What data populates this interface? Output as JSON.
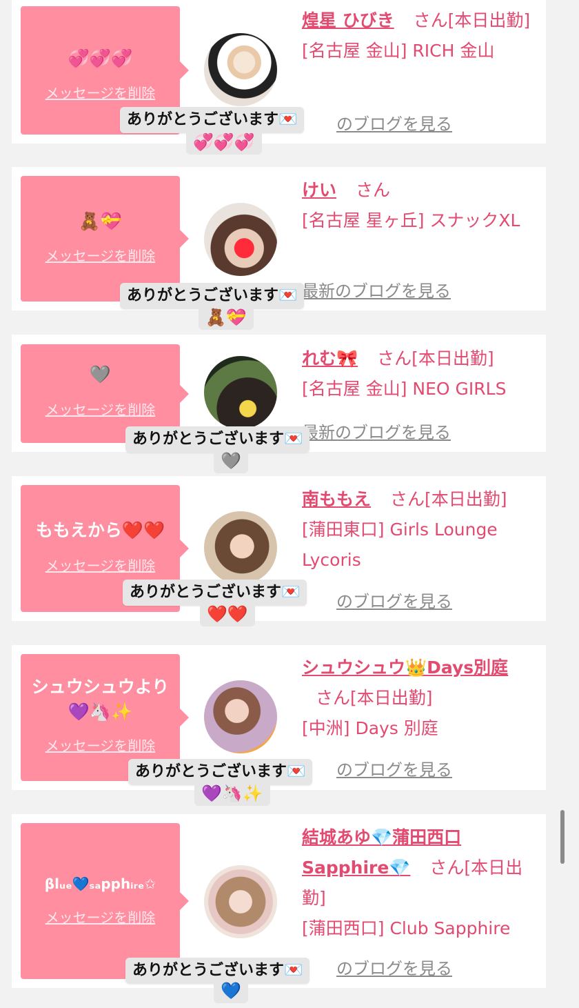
{
  "common": {
    "delete_label": "メッセージを削除",
    "blog_label": "のブログを見る",
    "san": "さん",
    "thanks_text": "ありがとうございます💌"
  },
  "colors": {
    "bubble": "#ff8ea0",
    "link": "#e24a70",
    "muted": "#8a8a8a",
    "page_bg": "#f2f2f2"
  },
  "cards": [
    {
      "message": "💞💞💞",
      "name": "煌星 ひびき",
      "status": "さん[本日出勤]",
      "shop": "[名古屋 金山] RICH 金山",
      "toast_emoji": "💞💞💞"
    },
    {
      "message": "🧸💝",
      "name": "けい",
      "status": "さん",
      "shop": "[名古屋 星ヶ丘] スナックXL",
      "blog_prefix": "最新",
      "toast_emoji": "🧸💝"
    },
    {
      "message": "🩶",
      "name": "れむ🎀",
      "status": "さん[本日出勤]",
      "shop": "[名古屋 金山] NEO GIRLS",
      "blog_prefix": "最新",
      "toast_emoji": "🩶"
    },
    {
      "message": "ももえから❤️❤️",
      "name": "南ももえ",
      "status": "さん[本日出勤]",
      "shop": "[蒲田東口] Girls Lounge Lycoris",
      "toast_emoji": "❤️❤️"
    },
    {
      "message": "シュウシュウより💜🦄✨",
      "name": "シュウシュウ👑Days別庭",
      "status": "さん[本日出勤]",
      "shop": "[中洲] Days 別庭",
      "toast_emoji": "💜🦄✨"
    },
    {
      "message": "βlᵤₑ💙ₛₐpphᵢᵣₑ✩",
      "name": "結城あゆ💎蒲田西口Sapphire💎",
      "status": "さん[本日出勤]",
      "shop": "[蒲田西口] Club Sapphire",
      "toast_emoji": "💙"
    }
  ]
}
